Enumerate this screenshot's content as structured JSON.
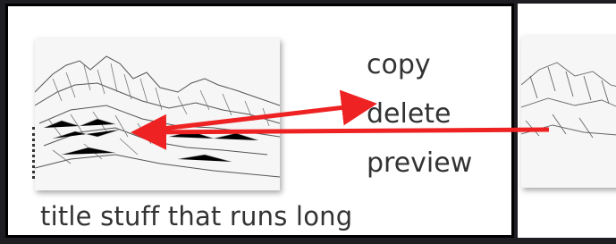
{
  "card": {
    "caption": "title stuff that runs long",
    "thumbnail": {
      "subject": "pencil-sketch-mountain-landscape"
    }
  },
  "menu": {
    "items": [
      {
        "label": "copy"
      },
      {
        "label": "delete"
      },
      {
        "label": "preview"
      }
    ]
  },
  "annotations": {
    "arrow_color": "#ee2222"
  },
  "colors": {
    "background": "#1d1d22",
    "panel": "#ffffff",
    "panel_border": "#000000",
    "text": "#333333"
  }
}
